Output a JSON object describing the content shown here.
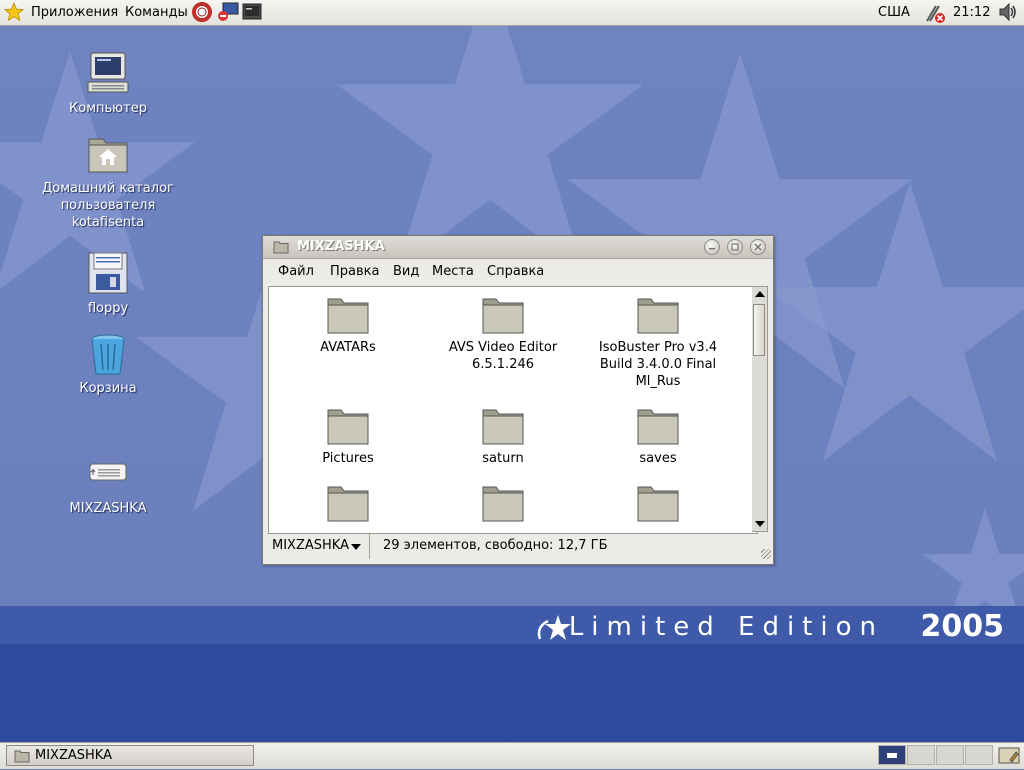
{
  "top_panel": {
    "applications_label": "Приложения",
    "actions_label": "Команды",
    "keyboard_layout": "США",
    "clock": "21:12"
  },
  "desktop": {
    "icons": [
      {
        "label": "Компьютер"
      },
      {
        "label": "Домашний каталог пользователя kotafisenta"
      },
      {
        "label": "floppy"
      },
      {
        "label": "Корзина"
      },
      {
        "label": "MIXZASHKA"
      }
    ],
    "brand_text": "Limited Edition",
    "brand_year": "2005"
  },
  "window": {
    "title": "MIXZASHKA",
    "menu": [
      "Файл",
      "Правка",
      "Вид",
      "Места",
      "Справка"
    ],
    "items": [
      {
        "label": "AVATARs"
      },
      {
        "label": "AVS Video Editor 6.5.1.246"
      },
      {
        "label": "IsoBuster Pro v3.4 Build 3.4.0.0 Final Ml_Rus"
      },
      {
        "label": "Pictures"
      },
      {
        "label": "saturn"
      },
      {
        "label": "saves"
      },
      {
        "label": ""
      },
      {
        "label": ""
      },
      {
        "label": ""
      }
    ],
    "location": "MIXZASHKA",
    "status": "29 элементов, свободно: 12,7 ГБ",
    "scroll_position": 0.02
  },
  "bottom_panel": {
    "task_label": "MIXZASHKA"
  },
  "colors": {
    "desktop": "#6f83c1",
    "stripe": "#2f4b9f",
    "panel": "#e8e6e1"
  }
}
